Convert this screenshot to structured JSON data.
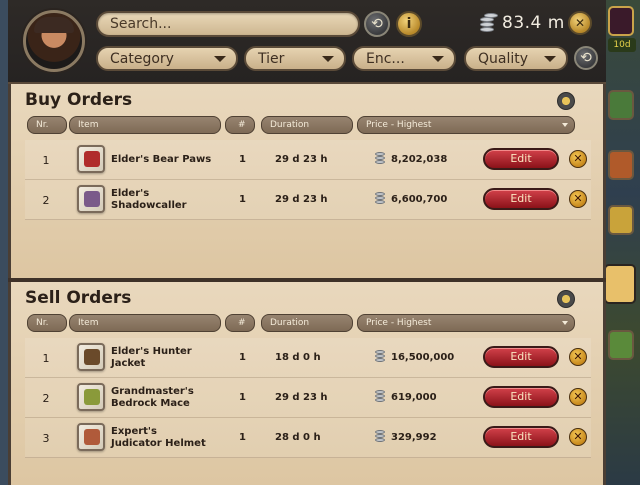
{
  "header": {
    "search_placeholder": "Search...",
    "info_label": "i",
    "silver_amount": "83.4 m",
    "close_label": "✕",
    "filters": {
      "category": "Category",
      "tier": "Tier",
      "enchantment": "Enc...",
      "quality": "Quality"
    }
  },
  "right_rail": {
    "badge_label": "10d"
  },
  "columns": {
    "nr": "Nr.",
    "item": "Item",
    "hash": "#",
    "duration": "Duration",
    "price": "Price - Highest"
  },
  "buy_orders": {
    "title": "Buy Orders",
    "rows": [
      {
        "nr": "1",
        "item": "Elder's Bear Paws",
        "qty": "1",
        "duration": "29 d 23 h",
        "price": "8,202,038",
        "edit": "Edit",
        "icon_color": "#b02c2c"
      },
      {
        "nr": "2",
        "item": "Elder's Shadowcaller",
        "qty": "1",
        "duration": "29 d 23 h",
        "price": "6,600,700",
        "edit": "Edit",
        "icon_color": "#7a5a8a"
      }
    ]
  },
  "sell_orders": {
    "title": "Sell Orders",
    "rows": [
      {
        "nr": "1",
        "item": "Elder's Hunter Jacket",
        "qty": "1",
        "duration": "18 d 0 h",
        "price": "16,500,000",
        "edit": "Edit",
        "icon_color": "#6a4a2a"
      },
      {
        "nr": "2",
        "item": "Grandmaster's Bedrock Mace",
        "qty": "1",
        "duration": "29 d 23 h",
        "price": "619,000",
        "edit": "Edit",
        "icon_color": "#8a9a3a"
      },
      {
        "nr": "3",
        "item": "Expert's Judicator Helmet",
        "qty": "1",
        "duration": "28 d 0 h",
        "price": "329,992",
        "edit": "Edit",
        "icon_color": "#b05a3a"
      }
    ]
  }
}
